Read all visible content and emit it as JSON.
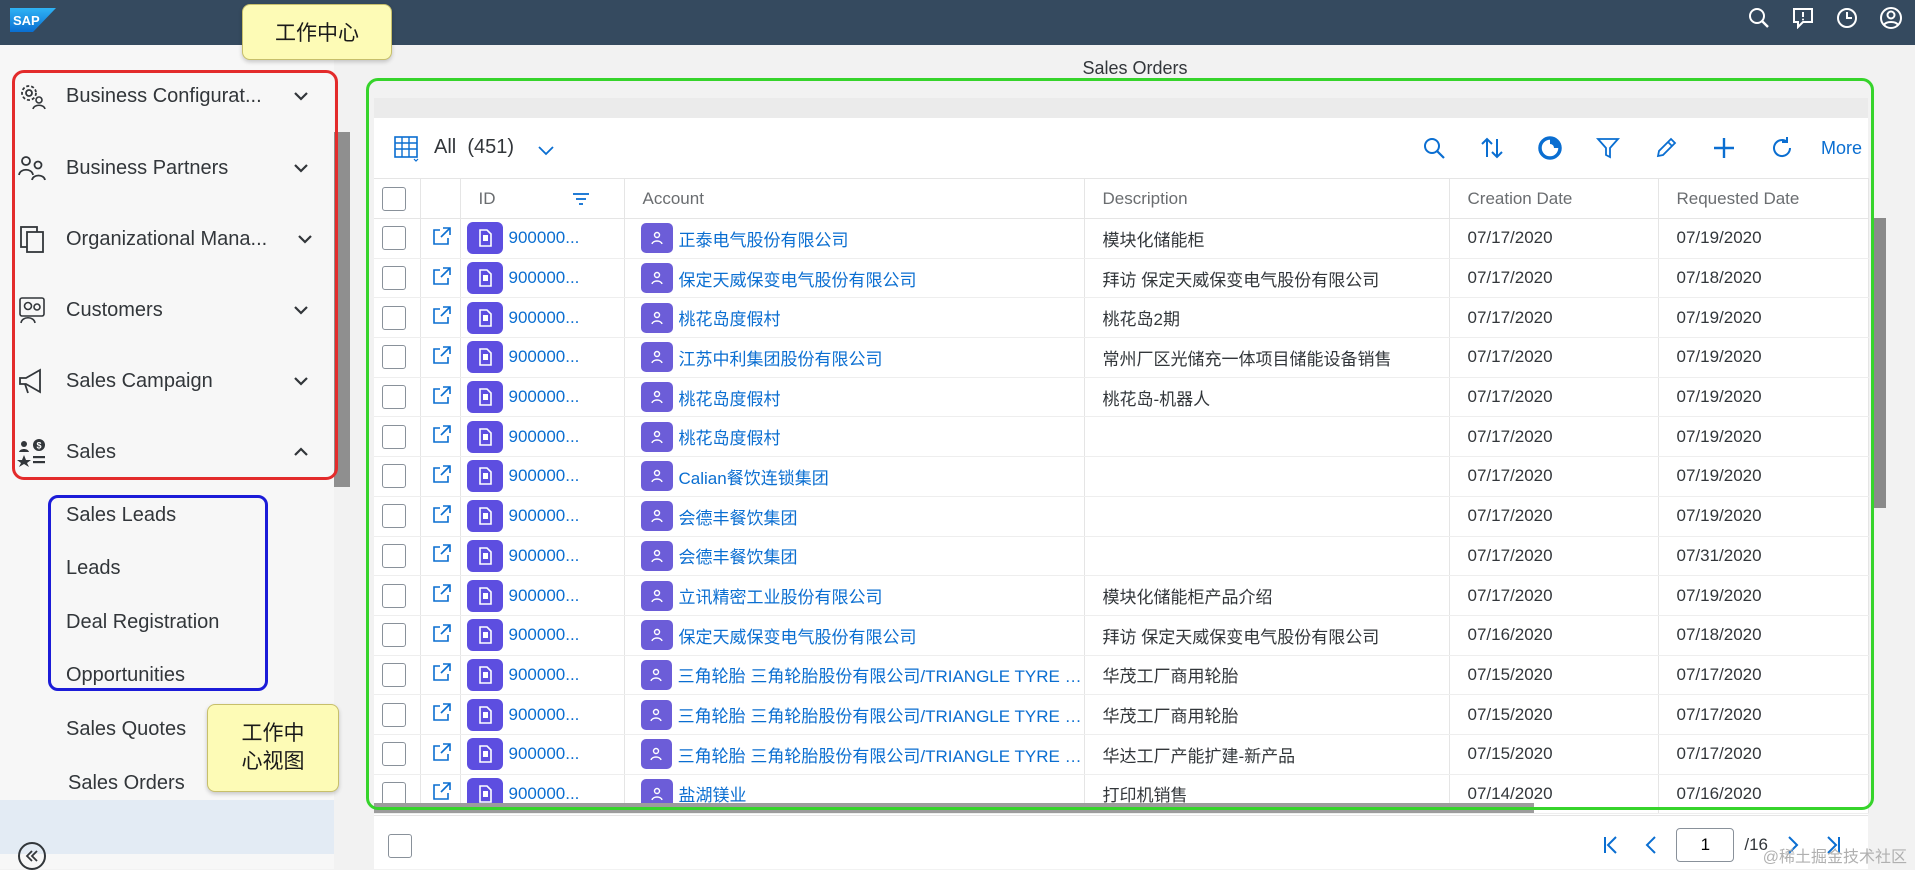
{
  "shell": {
    "logo_text": "SAP",
    "icons": [
      "search-icon",
      "feedback-icon",
      "history-icon",
      "user-icon"
    ]
  },
  "annotations": {
    "work_center": "工作中心",
    "work_center_view_line1": "工作中",
    "work_center_view_line2": "心视图"
  },
  "sidebar": {
    "groups": [
      {
        "label": "Business Configurat...",
        "icon": "gear-people-icon",
        "expanded": false
      },
      {
        "label": "Business Partners",
        "icon": "partners-icon",
        "expanded": false
      },
      {
        "label": "Organizational Mana...",
        "icon": "org-copy-icon",
        "expanded": false
      },
      {
        "label": "Customers",
        "icon": "customers-icon",
        "expanded": false
      },
      {
        "label": "Sales Campaign",
        "icon": "megaphone-icon",
        "expanded": false
      },
      {
        "label": "Sales",
        "icon": "sales-icon",
        "expanded": true
      }
    ],
    "sub_items": [
      "Sales Leads",
      "Leads",
      "Deal Registration",
      "Opportunities",
      "Sales Quotes",
      "Sales Orders"
    ],
    "selected": "Sales Orders"
  },
  "page": {
    "title": "Sales Orders"
  },
  "toolbar": {
    "view_label": "All",
    "count": "(451)",
    "more_label": "More",
    "actions": [
      "search-icon",
      "sort-icon",
      "group-icon",
      "filter-icon",
      "edit-icon",
      "add-icon",
      "refresh-icon"
    ]
  },
  "table": {
    "columns": [
      "ID",
      "Account",
      "Description",
      "Creation Date",
      "Requested Date"
    ],
    "rows": [
      {
        "id": "900000...",
        "account": "正泰电气股份有限公司",
        "description": "模块化储能柜",
        "created": "07/17/2020",
        "requested": "07/19/2020"
      },
      {
        "id": "900000...",
        "account": "保定天威保变电气股份有限公司",
        "description": "拜访 保定天威保变电气股份有限公司",
        "created": "07/17/2020",
        "requested": "07/18/2020"
      },
      {
        "id": "900000...",
        "account": "桃花岛度假村",
        "description": "桃花岛2期",
        "created": "07/17/2020",
        "requested": "07/19/2020"
      },
      {
        "id": "900000...",
        "account": "江苏中利集团股份有限公司",
        "description": "常州厂区光储充一体项目储能设备销售",
        "created": "07/17/2020",
        "requested": "07/19/2020"
      },
      {
        "id": "900000...",
        "account": "桃花岛度假村",
        "description": "桃花岛-机器人",
        "created": "07/17/2020",
        "requested": "07/19/2020"
      },
      {
        "id": "900000...",
        "account": "桃花岛度假村",
        "description": "",
        "created": "07/17/2020",
        "requested": "07/19/2020"
      },
      {
        "id": "900000...",
        "account": "Calian餐饮连锁集团",
        "description": "",
        "created": "07/17/2020",
        "requested": "07/19/2020"
      },
      {
        "id": "900000...",
        "account": "会德丰餐饮集团",
        "description": "",
        "created": "07/17/2020",
        "requested": "07/19/2020"
      },
      {
        "id": "900000...",
        "account": "会德丰餐饮集团",
        "description": "",
        "created": "07/17/2020",
        "requested": "07/31/2020"
      },
      {
        "id": "900000...",
        "account": "立讯精密工业股份有限公司",
        "description": "模块化储能柜产品介绍",
        "created": "07/17/2020",
        "requested": "07/19/2020"
      },
      {
        "id": "900000...",
        "account": "保定天威保变电气股份有限公司",
        "description": "拜访 保定天威保变电气股份有限公司",
        "created": "07/16/2020",
        "requested": "07/18/2020"
      },
      {
        "id": "900000...",
        "account": "三角轮胎 三角轮胎股份有限公司/TRIANGLE TYRE CO.",
        "description": "华茂工厂商用轮胎",
        "created": "07/15/2020",
        "requested": "07/17/2020"
      },
      {
        "id": "900000...",
        "account": "三角轮胎 三角轮胎股份有限公司/TRIANGLE TYRE CO.",
        "description": "华茂工厂商用轮胎",
        "created": "07/15/2020",
        "requested": "07/17/2020"
      },
      {
        "id": "900000...",
        "account": "三角轮胎 三角轮胎股份有限公司/TRIANGLE TYRE CO.",
        "description": "华达工厂产能扩建-新产品",
        "created": "07/15/2020",
        "requested": "07/17/2020"
      },
      {
        "id": "900000...",
        "account": "盐湖镁业",
        "description": "打印机销售",
        "created": "07/14/2020",
        "requested": "07/16/2020"
      }
    ]
  },
  "pager": {
    "current_page": "1",
    "total_pages": "/16"
  },
  "watermark": "@稀土掘金技术社区",
  "colors": {
    "shell": "#354a5f",
    "link": "#0a6ed1",
    "object_icon": "#5d4ee0",
    "annotation_red": "#e32b2b",
    "annotation_blue": "#1c1cd8",
    "annotation_green": "#36d42b",
    "note_bg": "#fdfbb6"
  }
}
